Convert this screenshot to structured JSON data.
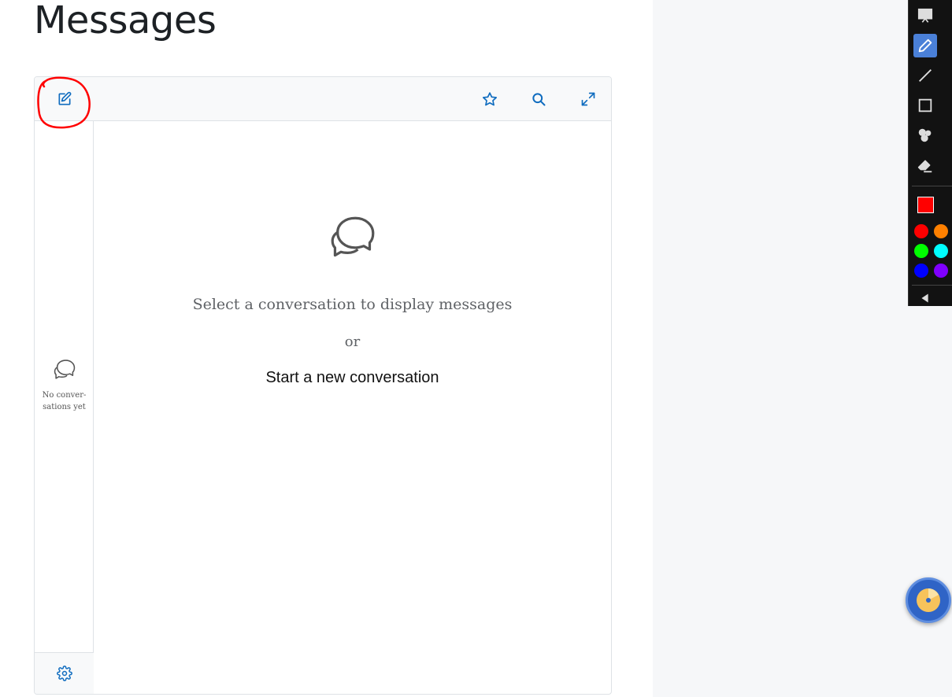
{
  "page": {
    "title": "Messages"
  },
  "sidebar": {
    "empty_text": "No conver-\nsations yet"
  },
  "main": {
    "select_text": "Select a conversation to display messages",
    "or_text": "or",
    "start_text": "Start a new conversation"
  },
  "icons": {
    "compose": "compose-icon",
    "star": "star-icon",
    "search": "search-icon",
    "expand": "expand-icon",
    "settings": "gear-icon",
    "chat": "chat-bubbles-icon"
  },
  "colors": {
    "accent": "#0f6cbf",
    "annotation": "#ff0000",
    "palette": [
      "#ff0000",
      "#ff8000",
      "#00ff00",
      "#00ffff",
      "#0000ff",
      "#8000ff"
    ]
  }
}
